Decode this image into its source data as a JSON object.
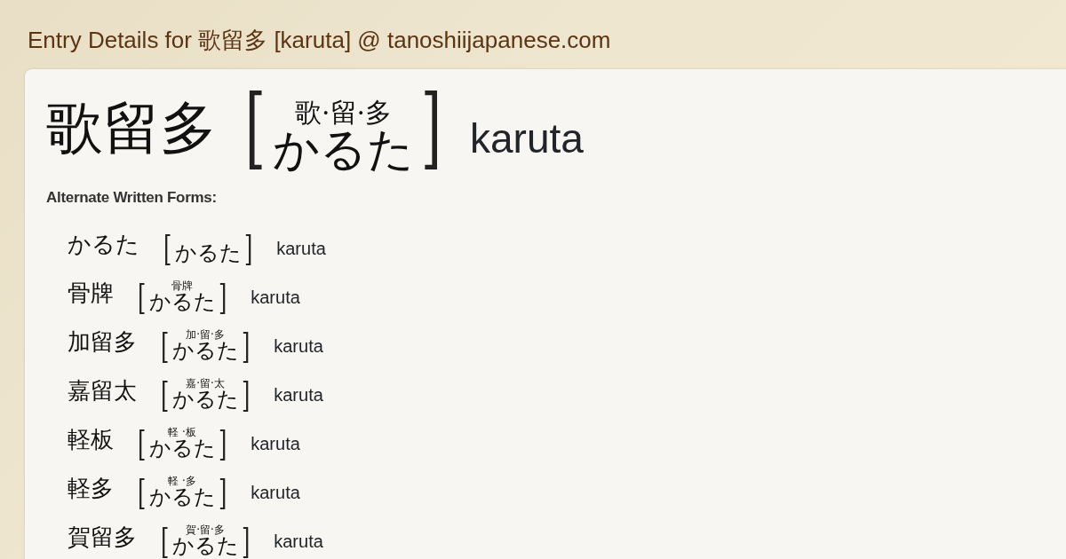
{
  "page_title": "Entry Details for 歌留多 [karuta] @ tanoshiijapanese.com",
  "entry": {
    "written": "歌留多",
    "open": "[",
    "furigana": "歌·留·多",
    "kana": "かるた",
    "close": "]",
    "romaji": "karuta"
  },
  "alternate_forms": {
    "heading": "Alternate Written Forms:",
    "items": [
      {
        "written": "かるた",
        "open": "[",
        "kana": "かるた",
        "close": "]",
        "romaji": "karuta"
      },
      {
        "written": "骨牌",
        "open": "[",
        "furigana": "骨牌",
        "kana": "かるた",
        "close": "]",
        "romaji": "karuta"
      },
      {
        "written": "加留多",
        "open": "[",
        "furigana": "加·留·多",
        "kana": "かるた",
        "close": "]",
        "romaji": "karuta"
      },
      {
        "written": "嘉留太",
        "open": "[",
        "furigana": "嘉·留·太",
        "kana": "かるた",
        "close": "]",
        "romaji": "karuta"
      },
      {
        "written": "軽板",
        "open": "[",
        "furigana": "軽 ·板",
        "kana": "かるた",
        "close": "]",
        "romaji": "karuta"
      },
      {
        "written": "軽多",
        "open": "[",
        "furigana": "軽 ·多",
        "kana": "かるた",
        "close": "]",
        "romaji": "karuta"
      },
      {
        "written": "賀留多",
        "open": "[",
        "furigana": "賀·留·多",
        "kana": "かるた",
        "close": "]",
        "romaji": "karuta"
      }
    ]
  }
}
